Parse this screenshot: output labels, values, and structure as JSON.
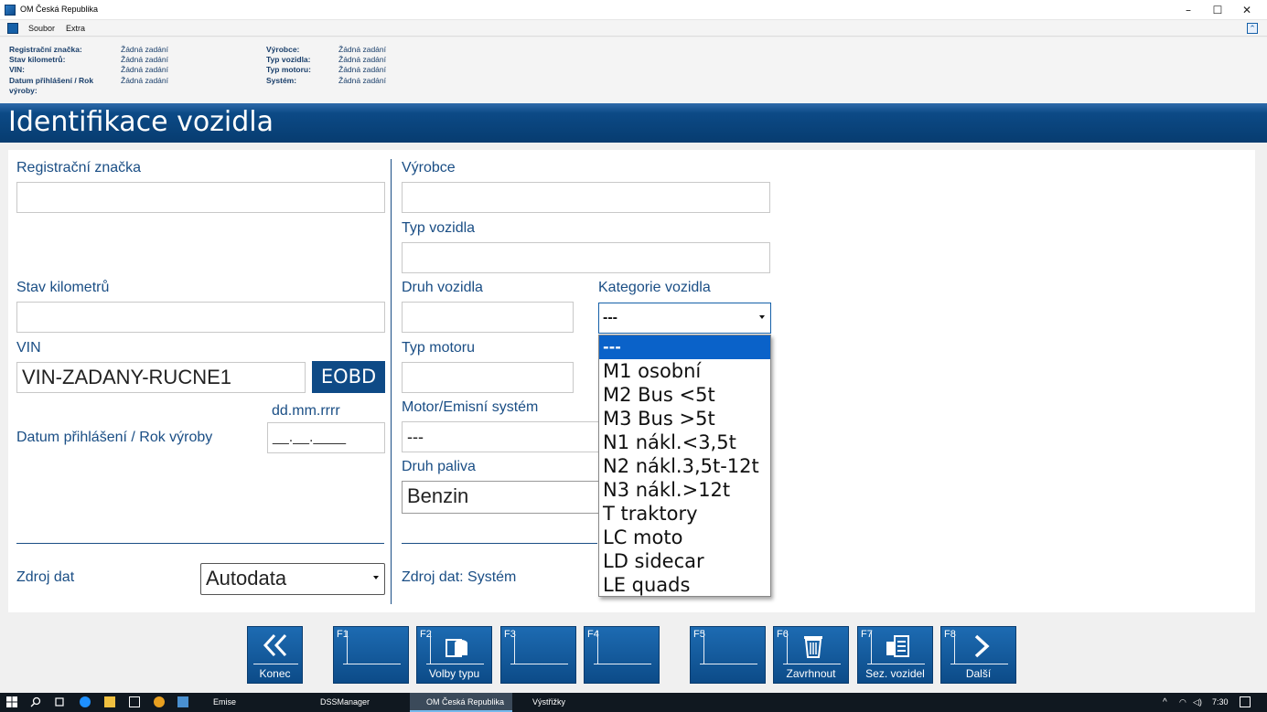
{
  "window": {
    "title": "OM Česká Republika"
  },
  "menu": {
    "items": [
      "Soubor",
      "Extra"
    ]
  },
  "summary": {
    "left": [
      {
        "label": "Registrační značka:",
        "value": "Žádná zadání"
      },
      {
        "label": "Stav kilometrů:",
        "value": "Žádná zadání"
      },
      {
        "label": "VIN:",
        "value": "Žádná zadání"
      },
      {
        "label": "Datum přihlášení / Rok výroby:",
        "value": "Žádná zadání"
      }
    ],
    "right": [
      {
        "label": "Výrobce:",
        "value": "Žádná zadání"
      },
      {
        "label": "Typ vozidla:",
        "value": "Žádná zadání"
      },
      {
        "label": "Typ motoru:",
        "value": "Žádná zadání"
      },
      {
        "label": "Systém:",
        "value": "Žádná zadání"
      }
    ]
  },
  "header": {
    "title": "Identifikace vozidla"
  },
  "form": {
    "reg_label": "Registrační značka",
    "reg_value": "",
    "km_label": "Stav kilometrů",
    "km_value": "",
    "vin_label": "VIN",
    "vin_value": "VIN-ZADANY-RUCNE1",
    "eobd_label": "EOBD",
    "date_format": "dd.mm.rrrr",
    "date_label": "Datum přihlášení / Rok výroby",
    "date_value": "__.__.____",
    "zdroj_label": "Zdroj dat",
    "zdroj_value": "Autodata",
    "vyrobce_label": "Výrobce",
    "vyrobce_value": "",
    "typ_label": "Typ vozidla",
    "typ_value": "",
    "druh_label": "Druh vozidla",
    "druh_value": "",
    "kat_label": "Kategorie vozidla",
    "kat_value": "---",
    "motor_label": "Typ motoru",
    "motor_value": "",
    "emis_label": "Motor/Emisní systém",
    "emis_value": "---",
    "palivo_label": "Druh paliva",
    "palivo_value": "Benzin",
    "zdroj_system_label": "Zdroj dat: Systém"
  },
  "dropdown": {
    "options": [
      "---",
      "M1 osobní",
      "M2 Bus <5t",
      "M3 Bus >5t",
      "N1 nákl.<3,5t",
      "N2 nákl.3,5t-12t",
      "N3 nákl.>12t",
      "T traktory",
      "LC moto",
      "LD sidecar",
      "LE quads"
    ],
    "selected_index": 0
  },
  "toolbar": {
    "keys": [
      {
        "num": "",
        "label": "Konec",
        "icon": "double-chevron-left-icon"
      },
      {
        "num": "F1",
        "label": "",
        "icon": ""
      },
      {
        "num": "F2",
        "label": "Volby typu",
        "icon": "vehicle-options-icon"
      },
      {
        "num": "F3",
        "label": "",
        "icon": ""
      },
      {
        "num": "F4",
        "label": "",
        "icon": ""
      },
      {
        "num": "F5",
        "label": "",
        "icon": ""
      },
      {
        "num": "F6",
        "label": "Zavrhnout",
        "icon": "trash-icon"
      },
      {
        "num": "F7",
        "label": "Sez. vozidel",
        "icon": "vehicle-list-icon"
      },
      {
        "num": "F8",
        "label": "Další",
        "icon": "chevron-right-icon"
      }
    ]
  },
  "taskbar": {
    "items": [
      "Emise",
      "DSSManager",
      "OM Česká Republika",
      "Výstřižky"
    ],
    "active": "OM Česká Republika",
    "clock": "7:30"
  },
  "colors": {
    "accent": "#0e4a86",
    "label": "#1a4e85",
    "selection": "#0a62c9"
  }
}
